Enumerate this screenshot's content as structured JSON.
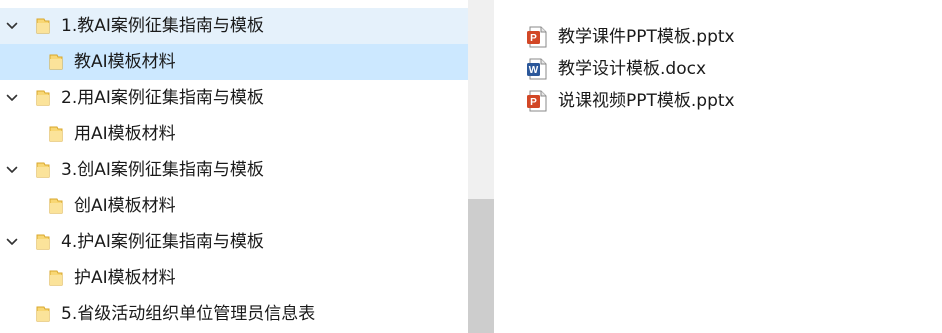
{
  "tree": {
    "items": [
      {
        "label": "1.教AI案例征集指南与模板",
        "level": 0,
        "expanded": true,
        "state": "hover",
        "icon": "folder-icon"
      },
      {
        "label": "教AI模板材料",
        "level": 1,
        "state": "selected",
        "icon": "folder-icon"
      },
      {
        "label": "2.用AI案例征集指南与模板",
        "level": 0,
        "expanded": true,
        "icon": "folder-icon"
      },
      {
        "label": "用AI模板材料",
        "level": 1,
        "icon": "folder-icon"
      },
      {
        "label": "3.创AI案例征集指南与模板",
        "level": 0,
        "expanded": true,
        "icon": "folder-icon"
      },
      {
        "label": "创AI模板材料",
        "level": 1,
        "icon": "folder-icon"
      },
      {
        "label": "4.护AI案例征集指南与模板",
        "level": 0,
        "expanded": true,
        "icon": "folder-icon"
      },
      {
        "label": "护AI模板材料",
        "level": 1,
        "icon": "folder-icon"
      },
      {
        "label": "5.省级活动组织单位管理员信息表",
        "level": 0,
        "expanded": false,
        "icon": "folder-icon"
      }
    ]
  },
  "files": [
    {
      "name": "教学课件PPT模板.pptx",
      "type": "pptx",
      "icon": "powerpoint-file-icon",
      "badge": "P"
    },
    {
      "name": "教学设计模板.docx",
      "type": "docx",
      "icon": "word-file-icon",
      "badge": "W"
    },
    {
      "name": "说课视频PPT模板.pptx",
      "type": "pptx",
      "icon": "powerpoint-file-icon",
      "badge": "P"
    }
  ],
  "colors": {
    "hover_bg": "#e5f1fb",
    "selected_bg": "#cce8ff",
    "folder": "#f8d775",
    "powerpoint": "#d24726",
    "word": "#2b579a",
    "scrollbar_track": "#f0f0f0",
    "scrollbar_thumb": "#cdcdcd"
  }
}
